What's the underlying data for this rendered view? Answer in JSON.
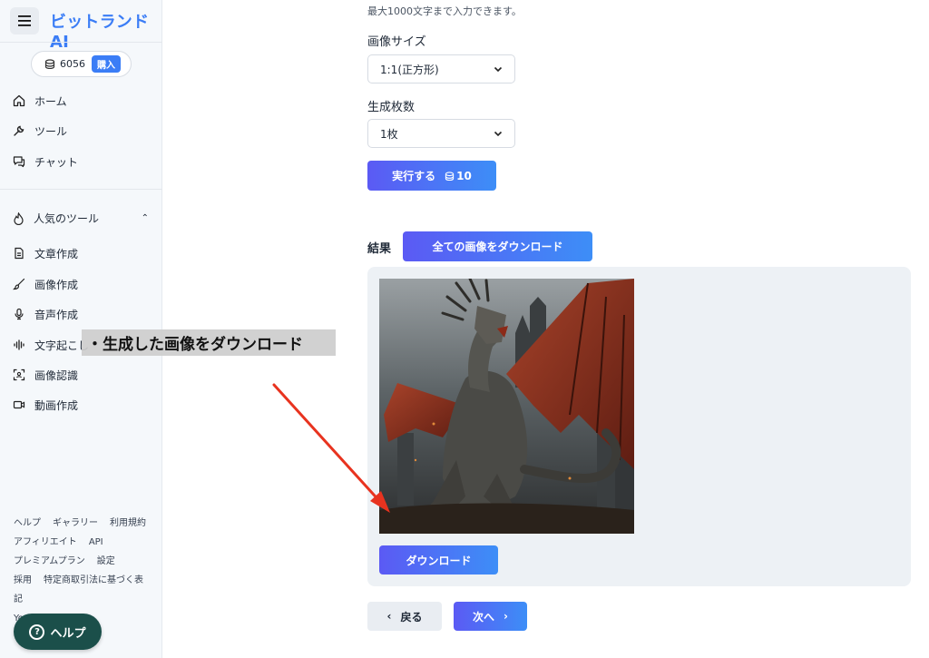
{
  "app": {
    "brand": "ビットランドAI",
    "menu_icon": "hamburger-icon"
  },
  "credits": {
    "amount": "6056",
    "buy_label": "購入",
    "icon": "coin-icon"
  },
  "nav": {
    "items": [
      {
        "label": "ホーム",
        "icon": "home-icon"
      },
      {
        "label": "ツール",
        "icon": "wrench-icon"
      },
      {
        "label": "チャット",
        "icon": "chat-icon"
      }
    ],
    "popular_header": "人気のツール",
    "popular_items": [
      {
        "label": "文章作成",
        "icon": "document-icon"
      },
      {
        "label": "画像作成",
        "icon": "brush-icon"
      },
      {
        "label": "音声作成",
        "icon": "microphone-icon"
      },
      {
        "label": "文字起こし",
        "icon": "waveform-icon"
      },
      {
        "label": "画像認識",
        "icon": "scan-icon"
      },
      {
        "label": "動画作成",
        "icon": "video-icon"
      }
    ]
  },
  "footer": {
    "links_row1": [
      "ヘルプ",
      "ギャラリー",
      "利用規約"
    ],
    "links_row2": [
      "アフィリエイト",
      "API"
    ],
    "links_row3": [
      "プレミアムプラン",
      "設定"
    ],
    "links_row4": [
      "採用",
      "特定商取引法に基づく表記"
    ],
    "links_row5": [
      "YouTube"
    ]
  },
  "help_button": {
    "label": "ヘルプ"
  },
  "form": {
    "char_limit_note": "最大1000文字まで入力できます。",
    "image_size_label": "画像サイズ",
    "image_size_value": "1:1(正方形)",
    "count_label": "生成枚数",
    "count_value": "1枚",
    "run_label": "実行する",
    "run_cost": "10"
  },
  "result": {
    "label": "結果",
    "download_all_label": "全ての画像をダウンロード",
    "download_label": "ダウンロード"
  },
  "pager": {
    "back_label": "戻る",
    "next_label": "次へ"
  },
  "annotation": {
    "text": "・生成した画像をダウンロード",
    "arrow_color": "#e8331f"
  },
  "colors": {
    "brand": "#3b7df6",
    "gradient_start": "#5b5af4",
    "gradient_end": "#3d8ef7",
    "help_bg": "#1b4f4a"
  }
}
